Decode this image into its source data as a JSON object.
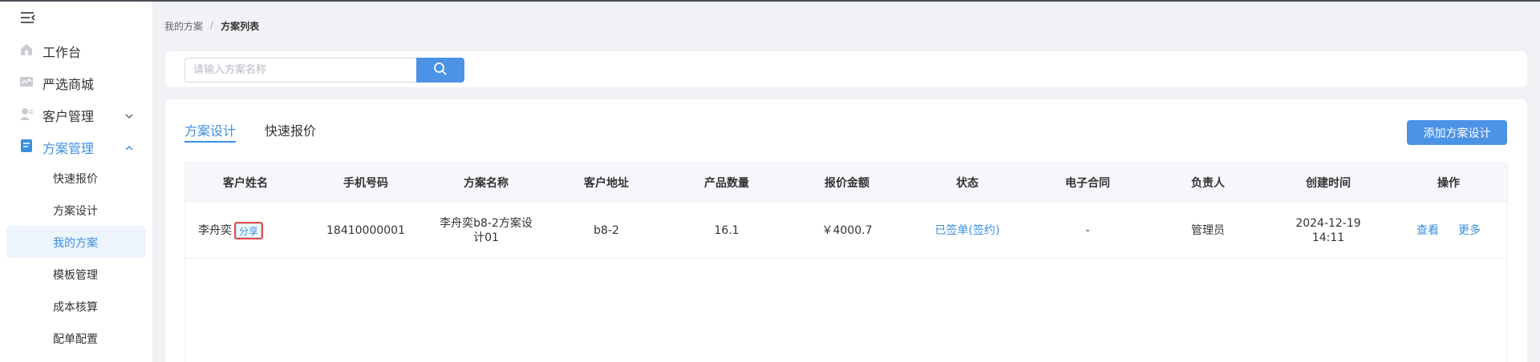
{
  "breadcrumb": {
    "parent": "我的方案",
    "separator": "/",
    "current": "方案列表"
  },
  "sidebar": {
    "menu": [
      {
        "label": "工作台",
        "icon": "home-icon"
      },
      {
        "label": "严选商城",
        "icon": "shop-icon"
      },
      {
        "label": "客户管理",
        "icon": "user-icon",
        "expandable": true
      },
      {
        "label": "方案管理",
        "icon": "document-icon",
        "expandable": true,
        "open": true
      }
    ],
    "submenu": [
      {
        "label": "快速报价"
      },
      {
        "label": "方案设计"
      },
      {
        "label": "我的方案",
        "active": true
      },
      {
        "label": "模板管理"
      },
      {
        "label": "成本核算"
      },
      {
        "label": "配单配置"
      }
    ]
  },
  "search": {
    "placeholder": "请输入方案名称",
    "value": ""
  },
  "tabs": [
    {
      "label": "方案设计",
      "active": true
    },
    {
      "label": "快速报价",
      "active": false
    }
  ],
  "add_button_label": "添加方案设计",
  "table": {
    "columns": [
      "客户姓名",
      "手机号码",
      "方案名称",
      "客户地址",
      "产品数量",
      "报价金额",
      "状态",
      "电子合同",
      "负责人",
      "创建时间",
      "操作"
    ],
    "rows": [
      {
        "customer_name": "李舟奕",
        "share_label": "分享",
        "phone": "18410000001",
        "plan_name": "李舟奕b8-2方案设计01",
        "address": "b8-2",
        "quantity": "16.1",
        "amount": "￥4000.7",
        "status": "已签单(签约)",
        "contract": "-",
        "owner": "管理员",
        "created_date": "2024-12-19",
        "created_time": "14:11",
        "actions": {
          "view": "查看",
          "more": "更多"
        }
      }
    ]
  },
  "colors": {
    "accent": "#3b8fe3",
    "primary_button": "#4c93e6",
    "highlight_border": "#e74b4b"
  }
}
